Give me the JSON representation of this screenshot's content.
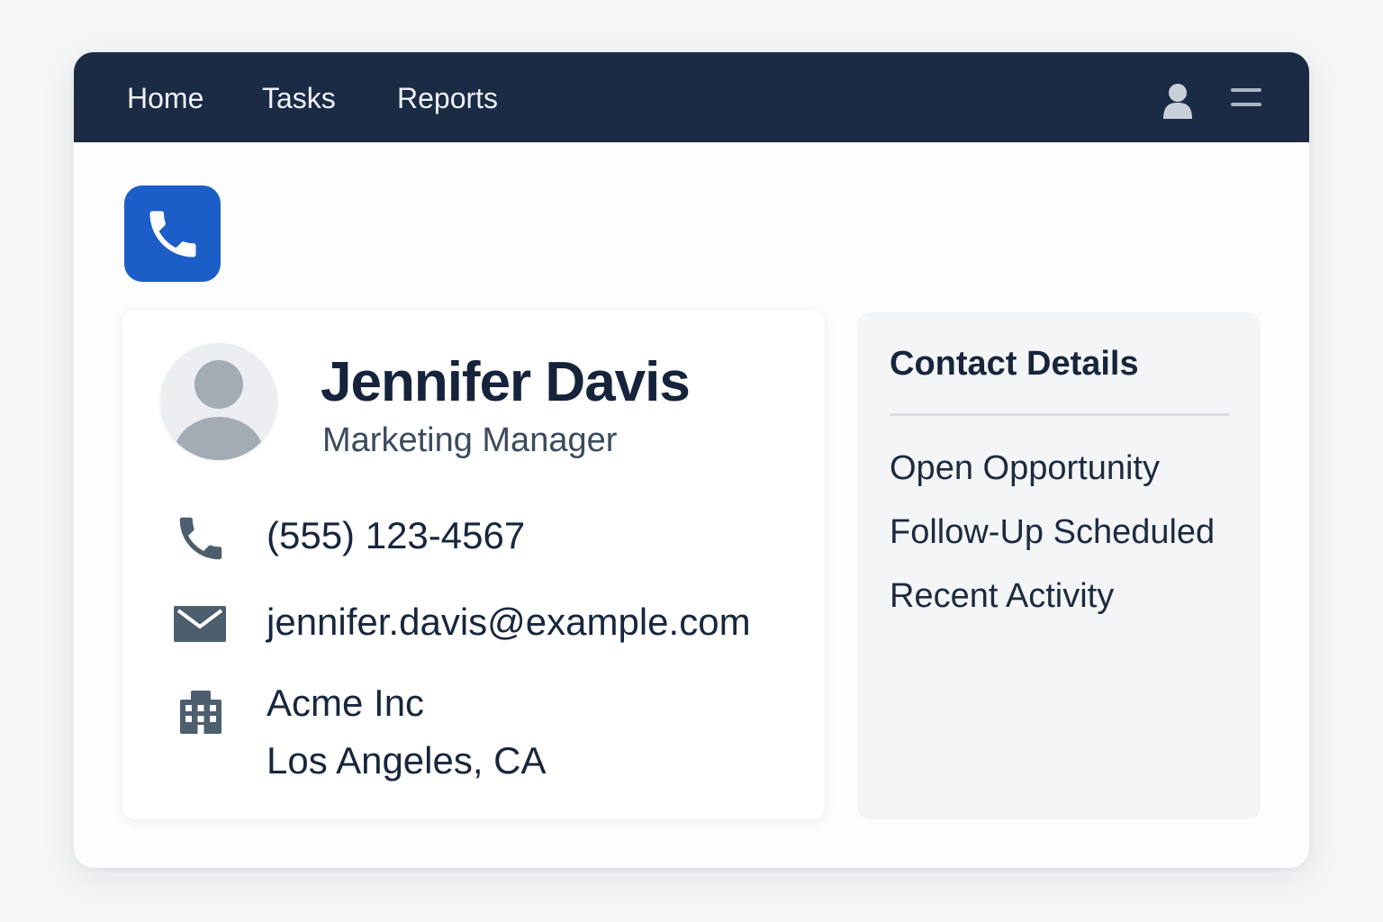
{
  "nav": {
    "items": [
      {
        "label": "Home"
      },
      {
        "label": "Tasks"
      },
      {
        "label": "Reports"
      }
    ],
    "user_icon": "user-icon",
    "menu_icon": "hamburger-menu-icon"
  },
  "app": {
    "icon": "phone-icon",
    "accent_color": "#1c5ec8"
  },
  "contact": {
    "name": "Jennifer Davis",
    "title": "Marketing Manager",
    "phone": "(555) 123-4567",
    "email": "jennifer.davis@example.com",
    "company": "Acme Inc",
    "location": "Los Angeles, CA"
  },
  "side_panel": {
    "title": "Contact Details",
    "items": [
      {
        "label": "Open Opportunity"
      },
      {
        "label": "Follow-Up Scheduled"
      },
      {
        "label": "Recent Activity"
      }
    ]
  },
  "colors": {
    "navbar": "#1b2b45",
    "icon_gray": "#4d5e6e"
  }
}
